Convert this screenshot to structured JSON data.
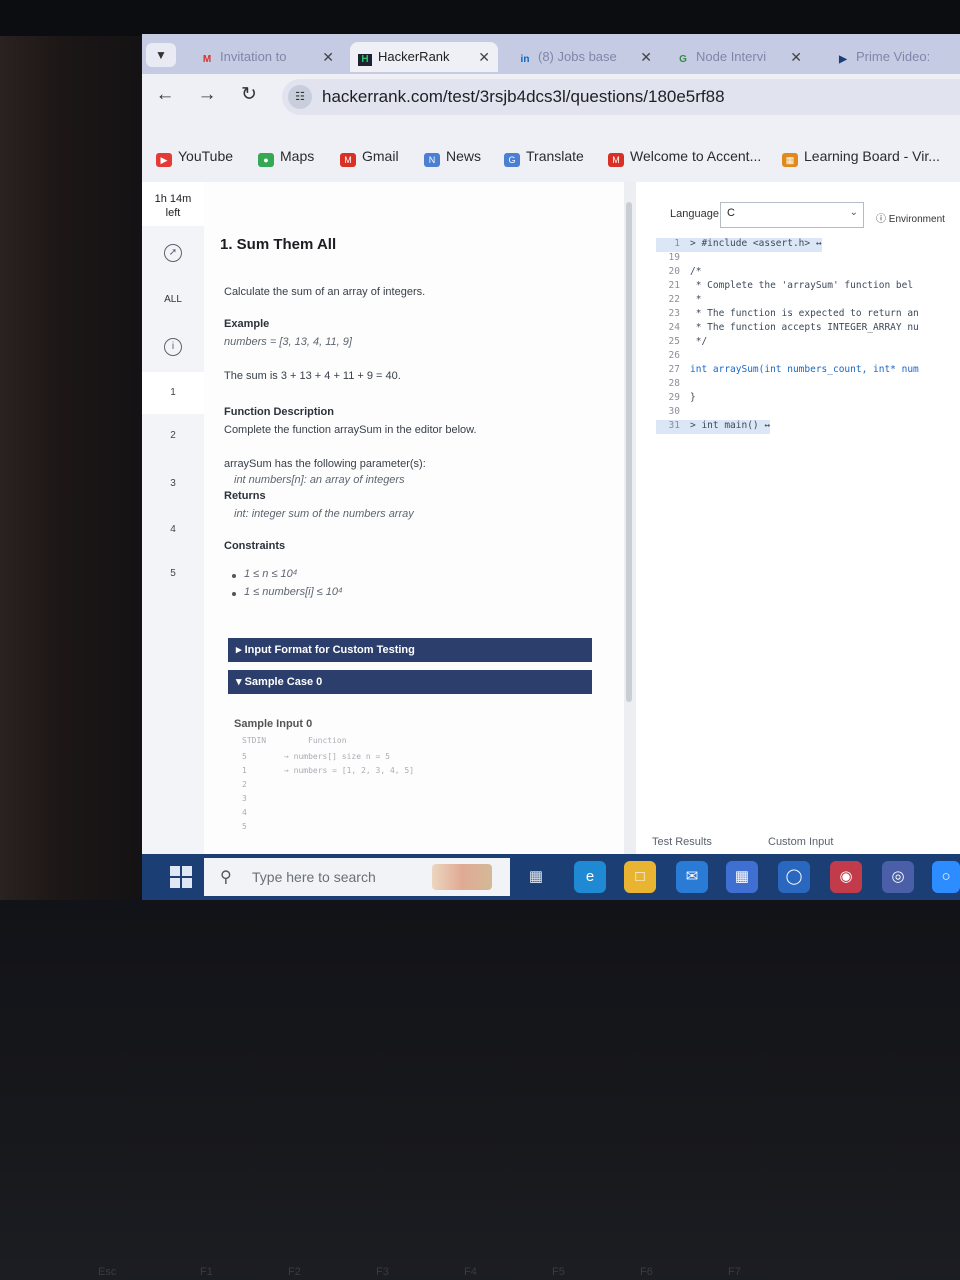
{
  "browser": {
    "tabs": [
      {
        "label": "Invitation to",
        "icon": "gmail-icon"
      },
      {
        "label": "HackerRank",
        "icon": "hackerrank-icon"
      },
      {
        "label": "(8) Jobs base",
        "icon": "linkedin-icon"
      },
      {
        "label": "Node Intervi",
        "icon": "gfg-icon"
      },
      {
        "label": "Prime Video:",
        "icon": "primevideo-icon"
      }
    ],
    "url": "hackerrank.com/test/3rsjb4dcs3l/questions/180e5rf88",
    "bookmarks": [
      {
        "label": "YouTube",
        "icon": "youtube-icon",
        "color": "#e53935"
      },
      {
        "label": "Maps",
        "icon": "maps-icon",
        "color": "#34a853"
      },
      {
        "label": "Gmail",
        "icon": "gmail-icon",
        "color": "#d93025"
      },
      {
        "label": "News",
        "icon": "news-icon",
        "color": "#4a7fd4"
      },
      {
        "label": "Translate",
        "icon": "translate-icon",
        "color": "#4a7fd4"
      },
      {
        "label": "Welcome to Accent...",
        "icon": "gmail-icon",
        "color": "#d93025"
      },
      {
        "label": "Learning Board - Vir...",
        "icon": "board-icon",
        "color": "#e08a1e"
      }
    ]
  },
  "sidebar": {
    "timer": {
      "time": "1h 14m",
      "label": "left"
    },
    "all_label": "ALL",
    "questions": [
      "1",
      "2",
      "3",
      "4",
      "5"
    ]
  },
  "problem": {
    "title": "1. Sum Them All",
    "intro": "Calculate the sum of an array of integers.",
    "example_heading": "Example",
    "example_input": "numbers = [3, 13, 4, 11, 9]",
    "example_output": "The sum is 3 + 13 + 4 + 11 + 9 = 40.",
    "fd_heading": "Function Description",
    "fd_text": "Complete the function arraySum in the editor below.",
    "params_heading": "arraySum has the following parameter(s):",
    "param_1": "int numbers[n]: an array of integers",
    "returns_heading": "Returns",
    "returns_text": "int: integer sum of the numbers array",
    "constraints_heading": "Constraints",
    "constraint_1": "1 ≤ n ≤ 10⁴",
    "constraint_2": "1 ≤ numbers[i] ≤ 10⁴",
    "input_format_label": "▸ Input Format for Custom Testing",
    "sample_case_label": "▾ Sample Case 0",
    "sample_input_label": "Sample Input 0",
    "stdin_header": "STDIN",
    "function_header": "Function",
    "stdin_lines": [
      "5",
      "1",
      "2",
      "3",
      "4",
      "5"
    ],
    "function_lines": [
      "→   numbers[] size n = 5",
      "→   numbers = [1, 2, 3, 4, 5]"
    ]
  },
  "editor": {
    "language_label": "Language",
    "language_value": "C",
    "environment_label": "ⓘ Environment",
    "code_lines": [
      {
        "n": "1",
        "text": "> #include <assert.h> ↔",
        "style": "hl"
      },
      {
        "n": "19",
        "text": "",
        "style": ""
      },
      {
        "n": "20",
        "text": "/*",
        "style": "ct"
      },
      {
        "n": "21",
        "text": " * Complete the 'arraySum' function bel",
        "style": "ct"
      },
      {
        "n": "22",
        "text": " *",
        "style": "ct"
      },
      {
        "n": "23",
        "text": " * The function is expected to return an",
        "style": "ct"
      },
      {
        "n": "24",
        "text": " * The function accepts INTEGER_ARRAY nu",
        "style": "ct"
      },
      {
        "n": "25",
        "text": " */",
        "style": "ct"
      },
      {
        "n": "26",
        "text": "",
        "style": ""
      },
      {
        "n": "27",
        "text": "int arraySum(int numbers_count, int* num",
        "style": "kw"
      },
      {
        "n": "28",
        "text": "",
        "style": ""
      },
      {
        "n": "29",
        "text": "}",
        "style": "ct"
      },
      {
        "n": "30",
        "text": "",
        "style": ""
      },
      {
        "n": "31",
        "text": "> int main() ↔",
        "style": "hl"
      }
    ],
    "bottom_tabs": [
      "Test Results",
      "Custom Input"
    ]
  },
  "taskbar": {
    "search_placeholder": "Type here to search",
    "apps": [
      "task-view-icon",
      "edge-icon",
      "file-explorer-icon",
      "mail-icon",
      "store-icon",
      "defender-icon",
      "app-icon",
      "chrome-icon",
      "zoom-icon"
    ]
  },
  "keyboard": {
    "keys": [
      "Esc",
      "F1",
      "F2",
      "F3",
      "F4",
      "F5",
      "F6",
      "F7"
    ]
  }
}
